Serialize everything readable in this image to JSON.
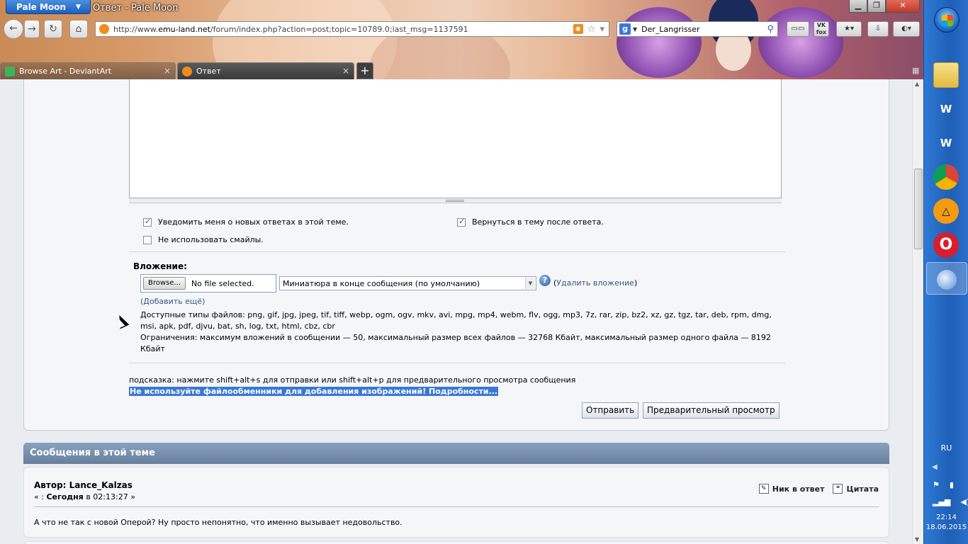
{
  "browser": {
    "app_button": "Pale Moon",
    "window_title": "Ответ - Pale Moon",
    "controls": {
      "minimize": "▁",
      "maximize": "❐",
      "close": "✕"
    },
    "url_prefix": "http://www.",
    "url_domain": "emu-land.net",
    "url_rest": "/forum/index.php?action=post;topic=10789.0;last_msg=1137591",
    "search_value": "Der_Langrisser",
    "vk_label": "VK fox",
    "tabs": [
      {
        "label": "Browse Art - DeviantArt",
        "active": false
      },
      {
        "label": "Ответ",
        "active": true
      }
    ],
    "new_tab": "+",
    "tab_close": "×"
  },
  "post_form": {
    "notify_label": "Уведомить меня о новых ответах в этой теме.",
    "notify_checked": true,
    "return_label": "Вернуться в тему после ответа.",
    "return_checked": true,
    "nosmileys_label": "Не использовать смайлы.",
    "nosmileys_checked": false,
    "attach_title": "Вложение:",
    "browse_button": "Browse...",
    "file_status": "No file selected.",
    "attach_option": "Миниатюра в конце сообщения (по умолчанию)",
    "remove_attach": "Удалить вложение",
    "add_more": "Добавить ещё",
    "allowed_types": "Доступные типы файлов: png, gif, jpg, jpeg, tif, tiff, webp, ogm, ogv, mkv, avi, mpg, mp4, webm, flv, ogg, mp3, 7z, rar, zip, bz2, xz, gz, tgz, tar, deb, rpm, dmg, msi, apk, pdf, djvu, bat, sh, log, txt, html, cbz, cbr",
    "limits": "Ограничения: максимум вложений в сообщении — 50, максимальный размер всех файлов — 32768 Кбайт, максимальный размер одного файла — 8192 Кбайт",
    "hint": "подсказка: нажмите shift+alt+s для отправки или shift+alt+p для предварительного просмотра сообщения",
    "notice": "Не используйте файлообменники для добавления изображений! Подробности...",
    "submit_button": "Отправить",
    "preview_button": "Предварительный просмотр"
  },
  "topic": {
    "header": "Сообщения в этой теме",
    "messages": [
      {
        "author": "Автор: Lance_Kalzas",
        "time_prefix": "« : ",
        "time_day": "Сегодня",
        "time_rest": " в 02:13:27 »",
        "quote_nick": "Ник в ответ",
        "quote": "Цитата",
        "body": "А что не так с новой Оперой? Ну просто непонятно, что именно вызывает недовольство."
      }
    ]
  },
  "taskbar": {
    "language": "RU",
    "time": "22:14",
    "date": "18.06.2015",
    "apps": [
      "folder-icon",
      "world-of-tanks-icon",
      "world-of-tanks-icon",
      "chrome-icon",
      "avast-icon",
      "opera-icon",
      "pale-moon-icon"
    ]
  },
  "colors": {
    "accent": "#3a78d6",
    "header": "#7690ae",
    "link": "#34568c"
  }
}
